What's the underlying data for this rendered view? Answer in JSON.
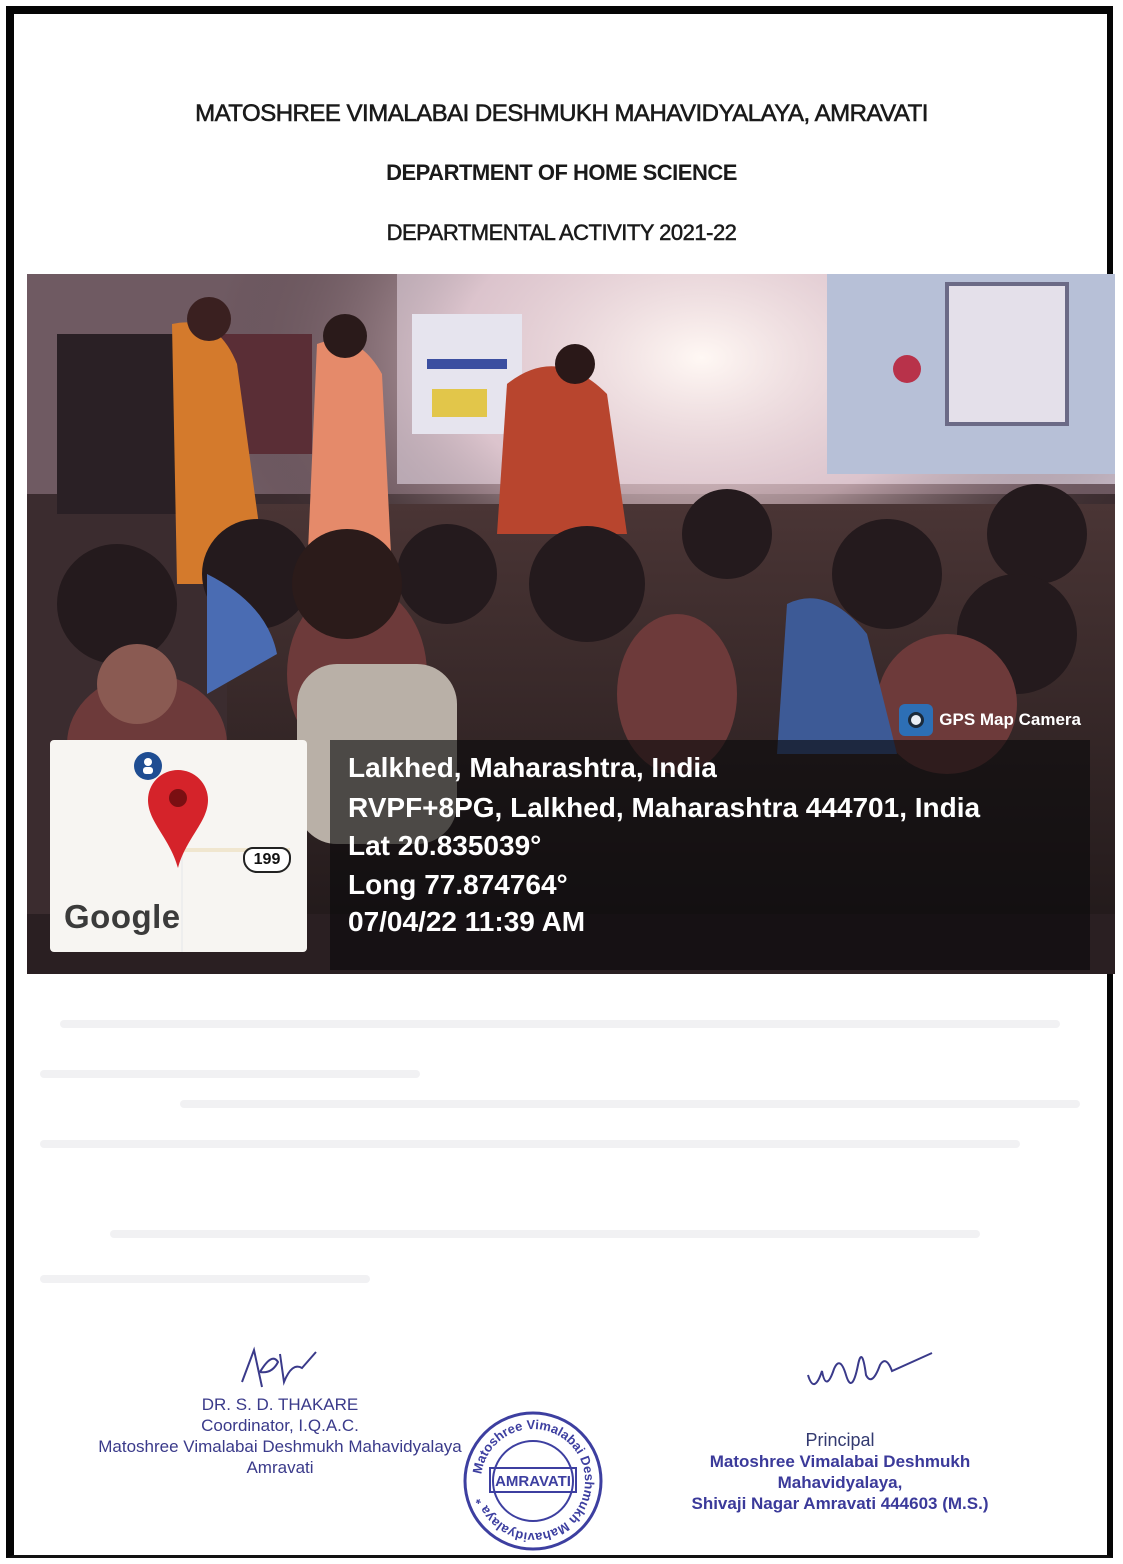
{
  "header": {
    "college": "MATOSHREE VIMALABAI DESHMUKH MAHAVIDYALAYA, AMRAVATI",
    "department": "DEPARTMENT OF HOME SCIENCE",
    "activity": "DEPARTMENTAL ACTIVITY 2021-22"
  },
  "photo": {
    "gps_label": "GPS Map Camera",
    "map_logo": "Google",
    "route_number": "199",
    "location_title": "Lalkhed, Maharashtra, India",
    "address": "RVPF+8PG, Lalkhed, Maharashtra 444701, India",
    "latitude": "Lat 20.835039°",
    "longitude": "Long 77.874764°",
    "timestamp": "07/04/22 11:39 AM"
  },
  "signatures": {
    "coordinator": {
      "name": "DR. S. D. THAKARE",
      "role": "Coordinator, I.Q.A.C.",
      "college": "Matoshree Vimalabai Deshmukh Mahavidyalaya",
      "city": "Amravati"
    },
    "stamp": {
      "ring_text": "Matoshree Vimalabai Deshmukh Mahavidyalaya *",
      "center": "AMRAVATI"
    },
    "principal": {
      "role": "Principal",
      "college": "Matoshree Vimalabai Deshmukh Mahavidyalaya,",
      "address": "Shivaji Nagar Amravati 444603 (M.S.)"
    }
  },
  "colors": {
    "stamp_ink": "#3d3fa0",
    "frame": "#050505"
  }
}
